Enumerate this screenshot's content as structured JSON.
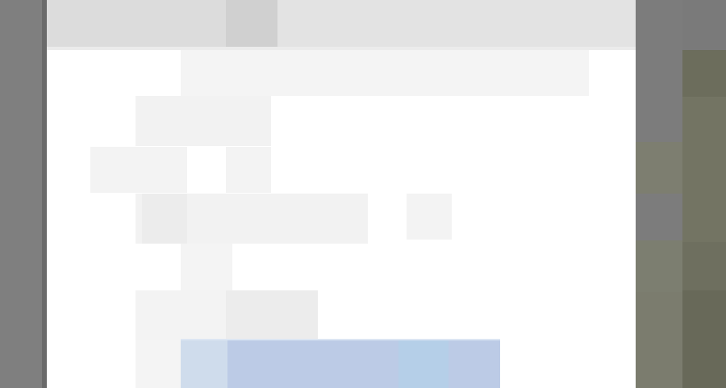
{
  "screen": {
    "description_colors": {
      "frame": "#7f7f7f",
      "window_header": "#e3e3e3",
      "window_body": "#ffffff",
      "selection_highlight": "#bccbe6",
      "side_panel": "#6f7060"
    }
  },
  "window": {
    "header": {
      "title": ""
    },
    "list": {
      "rows": [
        {
          "label": ""
        },
        {
          "label": ""
        },
        {
          "label": ""
        },
        {
          "label": ""
        },
        {
          "label": ""
        },
        {
          "label": ""
        }
      ],
      "selected_row": {
        "label": ""
      }
    }
  }
}
